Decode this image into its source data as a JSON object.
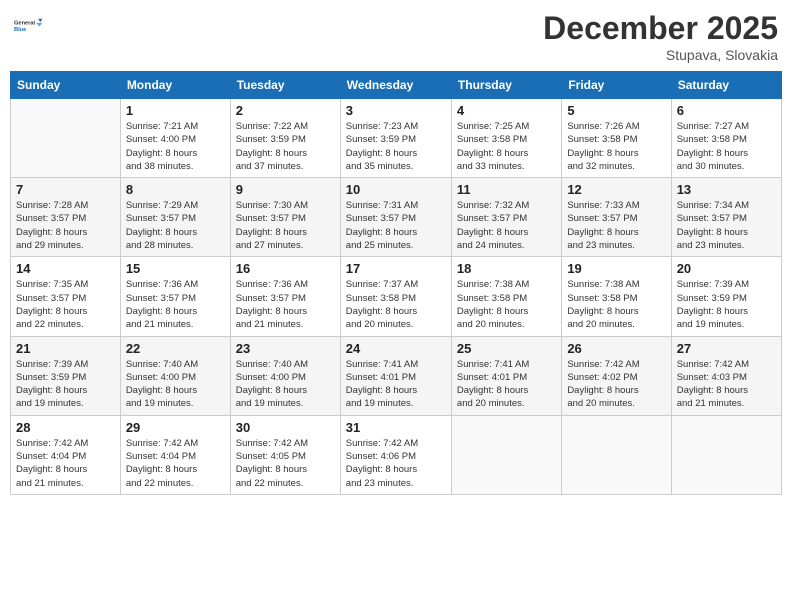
{
  "logo": {
    "line1": "General",
    "line2": "Blue"
  },
  "title": "December 2025",
  "subtitle": "Stupava, Slovakia",
  "days_header": [
    "Sunday",
    "Monday",
    "Tuesday",
    "Wednesday",
    "Thursday",
    "Friday",
    "Saturday"
  ],
  "weeks": [
    [
      {
        "day": "",
        "info": ""
      },
      {
        "day": "1",
        "info": "Sunrise: 7:21 AM\nSunset: 4:00 PM\nDaylight: 8 hours\nand 38 minutes."
      },
      {
        "day": "2",
        "info": "Sunrise: 7:22 AM\nSunset: 3:59 PM\nDaylight: 8 hours\nand 37 minutes."
      },
      {
        "day": "3",
        "info": "Sunrise: 7:23 AM\nSunset: 3:59 PM\nDaylight: 8 hours\nand 35 minutes."
      },
      {
        "day": "4",
        "info": "Sunrise: 7:25 AM\nSunset: 3:58 PM\nDaylight: 8 hours\nand 33 minutes."
      },
      {
        "day": "5",
        "info": "Sunrise: 7:26 AM\nSunset: 3:58 PM\nDaylight: 8 hours\nand 32 minutes."
      },
      {
        "day": "6",
        "info": "Sunrise: 7:27 AM\nSunset: 3:58 PM\nDaylight: 8 hours\nand 30 minutes."
      }
    ],
    [
      {
        "day": "7",
        "info": "Sunrise: 7:28 AM\nSunset: 3:57 PM\nDaylight: 8 hours\nand 29 minutes."
      },
      {
        "day": "8",
        "info": "Sunrise: 7:29 AM\nSunset: 3:57 PM\nDaylight: 8 hours\nand 28 minutes."
      },
      {
        "day": "9",
        "info": "Sunrise: 7:30 AM\nSunset: 3:57 PM\nDaylight: 8 hours\nand 27 minutes."
      },
      {
        "day": "10",
        "info": "Sunrise: 7:31 AM\nSunset: 3:57 PM\nDaylight: 8 hours\nand 25 minutes."
      },
      {
        "day": "11",
        "info": "Sunrise: 7:32 AM\nSunset: 3:57 PM\nDaylight: 8 hours\nand 24 minutes."
      },
      {
        "day": "12",
        "info": "Sunrise: 7:33 AM\nSunset: 3:57 PM\nDaylight: 8 hours\nand 23 minutes."
      },
      {
        "day": "13",
        "info": "Sunrise: 7:34 AM\nSunset: 3:57 PM\nDaylight: 8 hours\nand 23 minutes."
      }
    ],
    [
      {
        "day": "14",
        "info": "Sunrise: 7:35 AM\nSunset: 3:57 PM\nDaylight: 8 hours\nand 22 minutes."
      },
      {
        "day": "15",
        "info": "Sunrise: 7:36 AM\nSunset: 3:57 PM\nDaylight: 8 hours\nand 21 minutes."
      },
      {
        "day": "16",
        "info": "Sunrise: 7:36 AM\nSunset: 3:57 PM\nDaylight: 8 hours\nand 21 minutes."
      },
      {
        "day": "17",
        "info": "Sunrise: 7:37 AM\nSunset: 3:58 PM\nDaylight: 8 hours\nand 20 minutes."
      },
      {
        "day": "18",
        "info": "Sunrise: 7:38 AM\nSunset: 3:58 PM\nDaylight: 8 hours\nand 20 minutes."
      },
      {
        "day": "19",
        "info": "Sunrise: 7:38 AM\nSunset: 3:58 PM\nDaylight: 8 hours\nand 20 minutes."
      },
      {
        "day": "20",
        "info": "Sunrise: 7:39 AM\nSunset: 3:59 PM\nDaylight: 8 hours\nand 19 minutes."
      }
    ],
    [
      {
        "day": "21",
        "info": "Sunrise: 7:39 AM\nSunset: 3:59 PM\nDaylight: 8 hours\nand 19 minutes."
      },
      {
        "day": "22",
        "info": "Sunrise: 7:40 AM\nSunset: 4:00 PM\nDaylight: 8 hours\nand 19 minutes."
      },
      {
        "day": "23",
        "info": "Sunrise: 7:40 AM\nSunset: 4:00 PM\nDaylight: 8 hours\nand 19 minutes."
      },
      {
        "day": "24",
        "info": "Sunrise: 7:41 AM\nSunset: 4:01 PM\nDaylight: 8 hours\nand 19 minutes."
      },
      {
        "day": "25",
        "info": "Sunrise: 7:41 AM\nSunset: 4:01 PM\nDaylight: 8 hours\nand 20 minutes."
      },
      {
        "day": "26",
        "info": "Sunrise: 7:42 AM\nSunset: 4:02 PM\nDaylight: 8 hours\nand 20 minutes."
      },
      {
        "day": "27",
        "info": "Sunrise: 7:42 AM\nSunset: 4:03 PM\nDaylight: 8 hours\nand 21 minutes."
      }
    ],
    [
      {
        "day": "28",
        "info": "Sunrise: 7:42 AM\nSunset: 4:04 PM\nDaylight: 8 hours\nand 21 minutes."
      },
      {
        "day": "29",
        "info": "Sunrise: 7:42 AM\nSunset: 4:04 PM\nDaylight: 8 hours\nand 22 minutes."
      },
      {
        "day": "30",
        "info": "Sunrise: 7:42 AM\nSunset: 4:05 PM\nDaylight: 8 hours\nand 22 minutes."
      },
      {
        "day": "31",
        "info": "Sunrise: 7:42 AM\nSunset: 4:06 PM\nDaylight: 8 hours\nand 23 minutes."
      },
      {
        "day": "",
        "info": ""
      },
      {
        "day": "",
        "info": ""
      },
      {
        "day": "",
        "info": ""
      }
    ]
  ]
}
